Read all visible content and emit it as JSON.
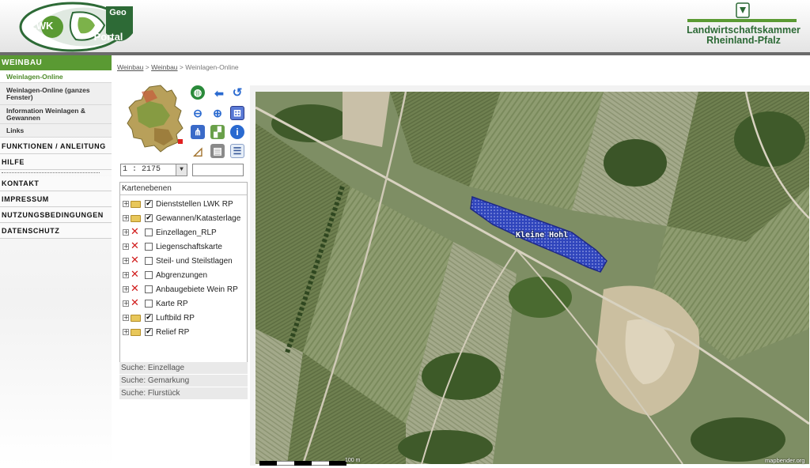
{
  "header": {
    "logo_left_letters": "LWK",
    "logo_left_geo": "Geo",
    "logo_left_portal": "Portal",
    "org_line1": "Landwirtschaftskammer",
    "org_line2": "Rheinland-Pfalz",
    "brand_green": "#2d6a36"
  },
  "nav": {
    "section_title": "WEINBAU",
    "sub_items": [
      {
        "label": "Weinlagen-Online"
      },
      {
        "label": "Weinlagen-Online (ganzes Fenster)"
      },
      {
        "label": "Information Weinlagen & Gewannen"
      },
      {
        "label": "Links"
      }
    ],
    "main_items": [
      {
        "label": "FUNKTIONEN / ANLEITUNG"
      },
      {
        "label": "HILFE"
      },
      {
        "label": "KONTAKT"
      },
      {
        "label": "IMPRESSUM"
      },
      {
        "label": "NUTZUNGSBEDINGUNGEN"
      },
      {
        "label": "DATENSCHUTZ"
      }
    ],
    "accent": "#5a9a33"
  },
  "breadcrumb": {
    "items": [
      "Weinbau",
      "Weinbau",
      "Weinlagen-Online"
    ],
    "separator": ">"
  },
  "controls": {
    "scale_value": "1 : 2175",
    "scale_input": "",
    "tools": [
      {
        "name": "globe-icon"
      },
      {
        "name": "back-arrow-icon"
      },
      {
        "name": "refresh-icon"
      },
      {
        "name": "zoom-out-icon"
      },
      {
        "name": "zoom-in-icon"
      },
      {
        "name": "zoom-box-icon"
      },
      {
        "name": "network-icon"
      },
      {
        "name": "map-pan-icon"
      },
      {
        "name": "info-icon"
      },
      {
        "name": "measure-icon"
      },
      {
        "name": "print-icon"
      },
      {
        "name": "legend-icon"
      }
    ]
  },
  "layers": {
    "title": "Kartenebenen",
    "items": [
      {
        "label": "Dienststellen LWK RP",
        "checked": true,
        "icon": "folder-icon"
      },
      {
        "label": "Gewannen/Katasterlage",
        "checked": true,
        "icon": "folder-icon"
      },
      {
        "label": "Einzellagen_RLP",
        "checked": false,
        "icon": "unavailable-icon"
      },
      {
        "label": "Liegenschaftskarte",
        "checked": false,
        "icon": "unavailable-icon"
      },
      {
        "label": "Steil- und Steilstlagen",
        "checked": false,
        "icon": "unavailable-icon"
      },
      {
        "label": "Abgrenzungen",
        "checked": false,
        "icon": "unavailable-icon"
      },
      {
        "label": "Anbaugebiete Wein RP",
        "checked": false,
        "icon": "unavailable-icon"
      },
      {
        "label": "Karte RP",
        "checked": false,
        "icon": "unavailable-icon"
      },
      {
        "label": "Luftbild RP",
        "checked": true,
        "icon": "folder-icon"
      },
      {
        "label": "Relief RP",
        "checked": true,
        "icon": "folder-icon"
      }
    ]
  },
  "search": {
    "items": [
      "Suche: Einzellage",
      "Suche: Gemarkung",
      "Suche: Flurstück"
    ]
  },
  "map": {
    "feature_label": "Kleine Hohl",
    "scalebar_label": "100 m",
    "credit": "mapbender.org",
    "highlight_color": "#2a3fc4"
  }
}
